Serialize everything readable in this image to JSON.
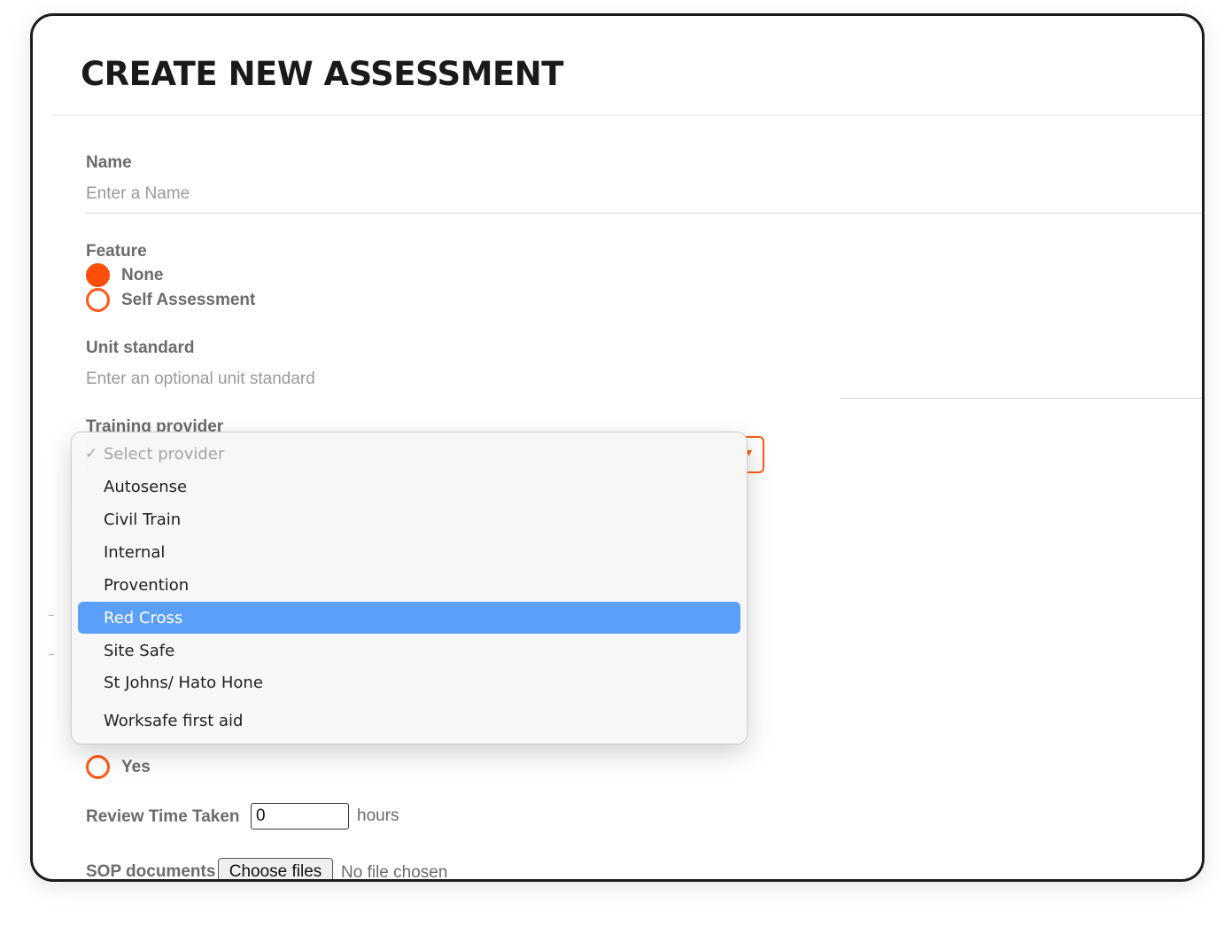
{
  "page": {
    "title": "CREATE NEW ASSESSMENT"
  },
  "form": {
    "name": {
      "label": "Name",
      "placeholder": "Enter a Name",
      "value": ""
    },
    "feature": {
      "label": "Feature",
      "options": [
        {
          "label": "None",
          "selected": true
        },
        {
          "label": "Self Assessment",
          "selected": false
        }
      ]
    },
    "unit_standard": {
      "label": "Unit standard",
      "placeholder": "Enter an optional unit standard",
      "value": ""
    },
    "training_provider": {
      "label": "Training provider",
      "placeholder_option": "Select provider",
      "check_icon": "checkmark-icon",
      "options": [
        "Autosense",
        "Civil Train",
        "Internal",
        "Provention",
        "Red Cross",
        "Site Safe",
        "St Johns/ Hato Hone",
        "Worksafe first aid"
      ],
      "highlighted": "Red Cross"
    },
    "yes_option": {
      "label": "Yes",
      "selected": false
    },
    "review_time": {
      "label": "Review Time Taken",
      "value": "0",
      "unit": "hours"
    },
    "sop_documents": {
      "label": "SOP documents",
      "button_label": "Choose files",
      "status": "No file chosen"
    }
  },
  "colors": {
    "accent": "#ff5a14",
    "highlight": "#5a9ff9",
    "label": "#6b6b6b",
    "placeholder": "#999999"
  }
}
